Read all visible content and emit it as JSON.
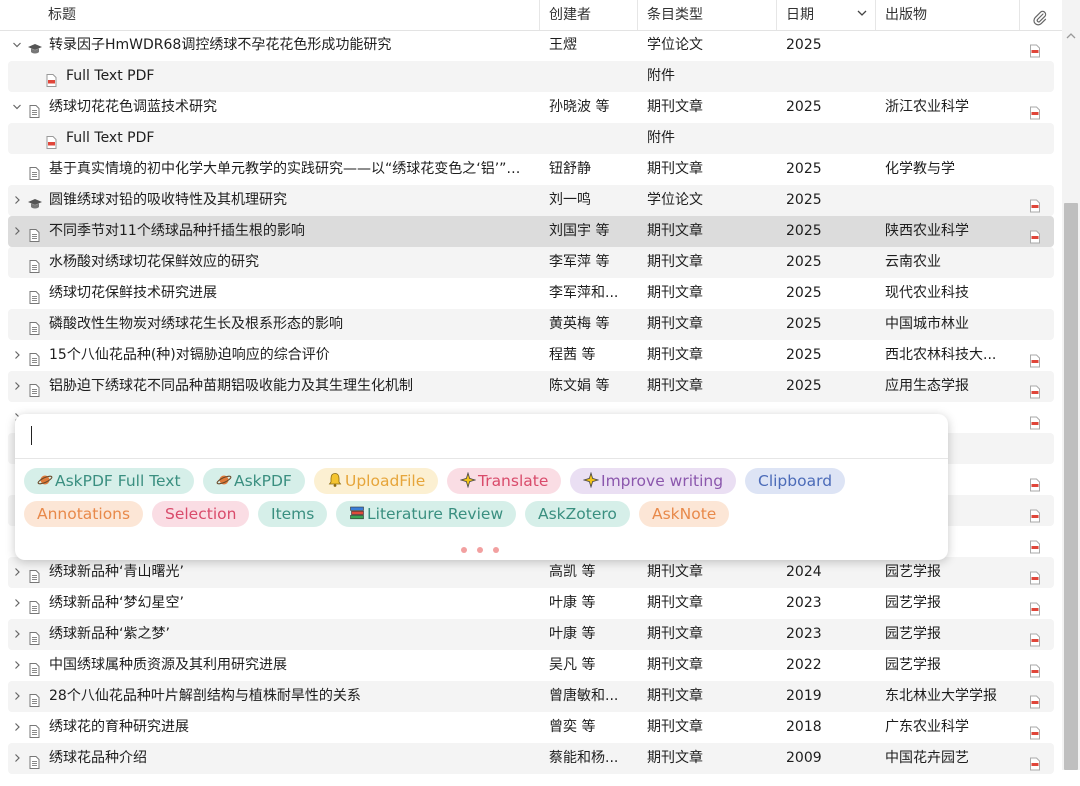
{
  "columns": {
    "title": "标题",
    "creator": "创建者",
    "item_type": "条目类型",
    "date": "日期",
    "publication": "出版物"
  },
  "rows": [
    {
      "twisty": "⌵",
      "icon": "thesis",
      "title": "转录因子HmWDR68调控绣球不孕花花色形成功能研究",
      "creator": "王熤",
      "type": "学位论文",
      "date": "2025",
      "pub": "",
      "pdf": true
    },
    {
      "child": true,
      "icon": "pdf",
      "title": "Full Text PDF",
      "creator": "",
      "type": "附件",
      "date": "",
      "pub": "",
      "pdf": false
    },
    {
      "twisty": "⌵",
      "icon": "doc",
      "title": "绣球切花花色调蓝技术研究",
      "creator": "孙晓波 等",
      "type": "期刊文章",
      "date": "2025",
      "pub": "浙江农业科学",
      "pdf": true
    },
    {
      "child": true,
      "icon": "pdf",
      "title": "Full Text PDF",
      "creator": "",
      "type": "附件",
      "date": "",
      "pub": "",
      "pdf": false
    },
    {
      "twisty": "",
      "icon": "doc",
      "title": "基于真实情境的初中化学大单元教学的实践研究——以“绣球花变色之‘铝’”…",
      "creator": "钮舒静",
      "type": "期刊文章",
      "date": "2025",
      "pub": "化学教与学",
      "pdf": false
    },
    {
      "twisty": "›",
      "icon": "thesis",
      "title": "圆锥绣球对铅的吸收特性及其机理研究",
      "creator": "刘一鸣",
      "type": "学位论文",
      "date": "2025",
      "pub": "",
      "pdf": true
    },
    {
      "twisty": "›",
      "icon": "doc",
      "title": "不同季节对11个绣球品种扦插生根的影响",
      "creator": "刘国宇 等",
      "type": "期刊文章",
      "date": "2025",
      "pub": "陕西农业科学",
      "pdf": true,
      "selected": true
    },
    {
      "twisty": "",
      "icon": "doc",
      "title": "水杨酸对绣球切花保鲜效应的研究",
      "creator": "李军萍 等",
      "type": "期刊文章",
      "date": "2025",
      "pub": "云南农业",
      "pdf": false
    },
    {
      "twisty": "",
      "icon": "doc",
      "title": "绣球切花保鲜技术研究进展",
      "creator": "李军萍和...",
      "type": "期刊文章",
      "date": "2025",
      "pub": "现代农业科技",
      "pdf": false
    },
    {
      "twisty": "",
      "icon": "doc",
      "title": "磷酸改性生物炭对绣球花生长及根系形态的影响",
      "creator": "黄英梅 等",
      "type": "期刊文章",
      "date": "2025",
      "pub": "中国城市林业",
      "pdf": false
    },
    {
      "twisty": "›",
      "icon": "doc",
      "title": "15个八仙花品种(种)对镉胁迫响应的综合评价",
      "creator": "程茜 等",
      "type": "期刊文章",
      "date": "2025",
      "pub": "西北农林科技大...",
      "pdf": true
    },
    {
      "twisty": "›",
      "icon": "doc",
      "title": "铝胁迫下绣球花不同品种苗期铝吸收能力及其生理生化机制",
      "creator": "陈文娟 等",
      "type": "期刊文章",
      "date": "2025",
      "pub": "应用生态学报",
      "pdf": true
    },
    {
      "twisty": "›",
      "icon": "doc",
      "title": "",
      "creator": "",
      "type": "",
      "date": "",
      "pub": "",
      "pdf": true
    },
    {
      "twisty": "",
      "icon": "",
      "title": "",
      "creator": "",
      "type": "",
      "date": "",
      "pub": "",
      "pdf": false
    },
    {
      "twisty": "›",
      "icon": "doc",
      "title": "",
      "creator": "",
      "type": "",
      "date": "",
      "pub": "",
      "pdf": true
    },
    {
      "twisty": "›",
      "icon": "doc",
      "title": "",
      "creator": "",
      "type": "",
      "date": "",
      "pub": "",
      "pdf": true
    },
    {
      "twisty": "›",
      "icon": "doc",
      "title": "",
      "creator": "",
      "type": "",
      "date": "",
      "pub": "",
      "pdf": true
    },
    {
      "twisty": "›",
      "icon": "doc",
      "title": "绣球新品种‘青山曙光’",
      "creator": "高凯 等",
      "type": "期刊文章",
      "date": "2024",
      "pub": "园艺学报",
      "pdf": true
    },
    {
      "twisty": "›",
      "icon": "doc",
      "title": "绣球新品种‘梦幻星空’",
      "creator": "叶康 等",
      "type": "期刊文章",
      "date": "2023",
      "pub": "园艺学报",
      "pdf": true
    },
    {
      "twisty": "›",
      "icon": "doc",
      "title": "绣球新品种‘紫之梦’",
      "creator": "叶康 等",
      "type": "期刊文章",
      "date": "2023",
      "pub": "园艺学报",
      "pdf": true
    },
    {
      "twisty": "›",
      "icon": "doc",
      "title": "中国绣球属种质资源及其利用研究进展",
      "creator": "吴凡 等",
      "type": "期刊文章",
      "date": "2022",
      "pub": "园艺学报",
      "pdf": true
    },
    {
      "twisty": "›",
      "icon": "doc",
      "title": "28个八仙花品种叶片解剖结构与植株耐旱性的关系",
      "creator": "曾唐敏和...",
      "type": "期刊文章",
      "date": "2019",
      "pub": "东北林业大学学报",
      "pdf": true
    },
    {
      "twisty": "›",
      "icon": "doc",
      "title": "绣球花的育种研究进展",
      "creator": "曾奕 等",
      "type": "期刊文章",
      "date": "2018",
      "pub": "广东农业科学",
      "pdf": true
    },
    {
      "twisty": "›",
      "icon": "doc",
      "title": "绣球花品种介绍",
      "creator": "蔡能和杨...",
      "type": "期刊文章",
      "date": "2009",
      "pub": "中国花卉园艺",
      "pdf": true
    }
  ],
  "popup": {
    "input_value": "",
    "row1": [
      {
        "label": "AskPDF Full Text",
        "icon": "planet-icon",
        "bg": "#d6efe9",
        "fg": "#3a8f80"
      },
      {
        "label": "AskPDF",
        "icon": "planet-icon",
        "bg": "#d6efe9",
        "fg": "#3a8f80"
      },
      {
        "label": "UploadFile",
        "icon": "bell-icon",
        "bg": "#fcf0d2",
        "fg": "#e6a53a"
      },
      {
        "label": "Translate",
        "icon": "sparkle-icon",
        "bg": "#fadde4",
        "fg": "#d94b6b"
      },
      {
        "label": "Improve writing",
        "icon": "sparkle-icon",
        "bg": "#eadff3",
        "fg": "#8b57ad"
      },
      {
        "label": "Clipboard",
        "icon": "",
        "bg": "#dde4f5",
        "fg": "#4b6bb8"
      }
    ],
    "row2": [
      {
        "label": "Annotations",
        "icon": "",
        "bg": "#fce6d6",
        "fg": "#e8894a"
      },
      {
        "label": "Selection",
        "icon": "",
        "bg": "#fadde4",
        "fg": "#d94b6b"
      },
      {
        "label": "Items",
        "icon": "",
        "bg": "#d6efe9",
        "fg": "#3a8f80"
      },
      {
        "label": "Literature Review",
        "icon": "books-icon",
        "bg": "#d6efe9",
        "fg": "#3a8f80"
      },
      {
        "label": "AskZotero",
        "icon": "",
        "bg": "#d6efe9",
        "fg": "#3a8f80"
      },
      {
        "label": "AskNote",
        "icon": "",
        "bg": "#fce6d6",
        "fg": "#e8894a"
      }
    ]
  }
}
